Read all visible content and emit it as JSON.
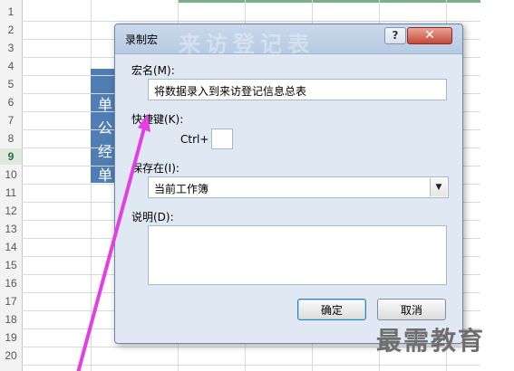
{
  "sheet": {
    "rows": [
      "1",
      "2",
      "3",
      "4",
      "5",
      "6",
      "7",
      "8",
      "9",
      "10",
      "11",
      "12",
      "13",
      "14",
      "15",
      "16",
      "17",
      "18",
      "19",
      "20"
    ],
    "active_row": "9",
    "blue_cell_chars": [
      "单",
      "公",
      "经",
      "单"
    ]
  },
  "dialog": {
    "title": "录制宏",
    "watermark": "来访登记表",
    "help_label": "?",
    "close_label": "✕",
    "macro_name_label": "宏名(M):",
    "macro_name_value": "将数据录入到来访登记信息总表",
    "shortcut_label": "快捷键(K):",
    "ctrl_label": "Ctrl+",
    "shortcut_value": "",
    "store_label": "保存在(I):",
    "store_value": "当前工作簿",
    "description_label": "说明(D):",
    "description_value": "",
    "ok_label": "确定",
    "cancel_label": "取消"
  },
  "brand": "最需教育",
  "colors": {
    "arrow": "#e33fe3",
    "blue_cell": "#4f7db4",
    "active_row": "#217346"
  }
}
